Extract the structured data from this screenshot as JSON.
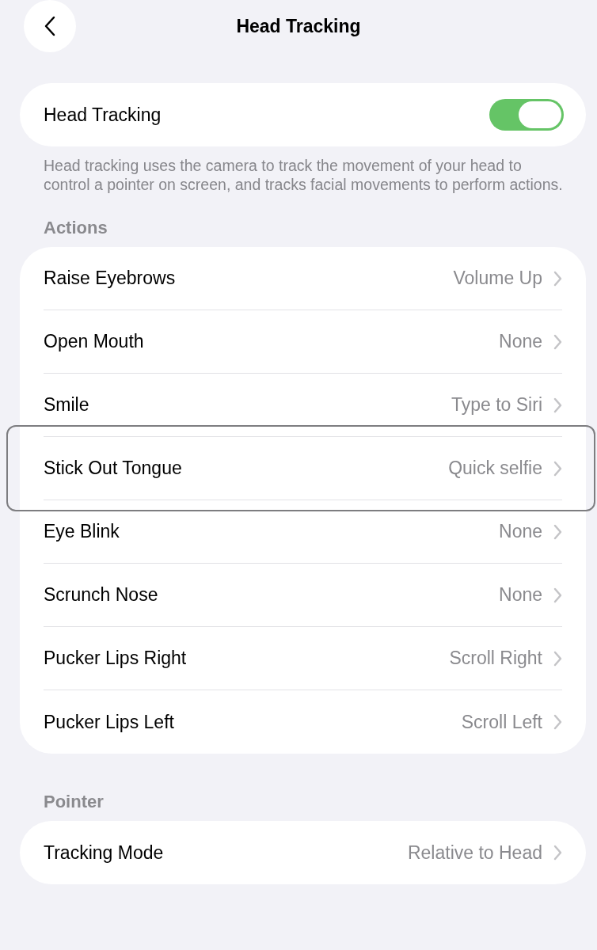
{
  "title": "Head Tracking",
  "main_toggle": {
    "label": "Head Tracking",
    "on": true
  },
  "description": "Head tracking uses the camera to track the movement of your head to control a pointer on screen, and tracks facial movements to perform actions.",
  "sections": [
    {
      "header": "Actions",
      "rows": [
        {
          "label": "Raise Eyebrows",
          "value": "Volume Up",
          "highlighted": false
        },
        {
          "label": "Open Mouth",
          "value": "None",
          "highlighted": false
        },
        {
          "label": "Smile",
          "value": "Type to Siri",
          "highlighted": false
        },
        {
          "label": "Stick Out Tongue",
          "value": "Quick selfie",
          "highlighted": true
        },
        {
          "label": "Eye Blink",
          "value": "None",
          "highlighted": false
        },
        {
          "label": "Scrunch Nose",
          "value": "None",
          "highlighted": false
        },
        {
          "label": "Pucker Lips Right",
          "value": "Scroll Right",
          "highlighted": false
        },
        {
          "label": "Pucker Lips Left",
          "value": "Scroll Left",
          "highlighted": false
        }
      ]
    },
    {
      "header": "Pointer",
      "rows": [
        {
          "label": "Tracking Mode",
          "value": "Relative to Head",
          "highlighted": false
        }
      ]
    }
  ]
}
